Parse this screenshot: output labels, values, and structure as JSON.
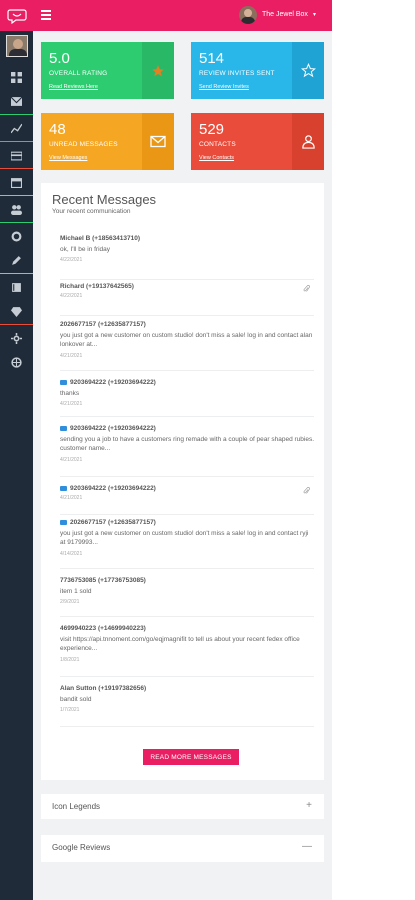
{
  "colors": {
    "accent": "#e91e63",
    "sidebar_bg": "#1f2b39",
    "green": "#2ecc71",
    "blue": "#29b6e8",
    "orange": "#f5a623",
    "red": "#ea4c3b"
  },
  "topbar": {
    "user_name": "The Jewel Box",
    "caret": "▾"
  },
  "sidebar": {
    "items": [
      {
        "icon": "dashboard-icon"
      },
      {
        "icon": "mail-icon"
      },
      {
        "icon": "chart-icon"
      },
      {
        "icon": "card-icon"
      },
      {
        "icon": "calendar-icon"
      },
      {
        "icon": "users-icon"
      },
      {
        "icon": "settings-icon"
      },
      {
        "icon": "edit-icon"
      },
      {
        "icon": "book-icon"
      },
      {
        "icon": "diamond-icon"
      },
      {
        "icon": "gear-icon"
      },
      {
        "icon": "globe-icon"
      }
    ]
  },
  "stats": [
    {
      "value": "5.0",
      "label": "OVERALL RATING",
      "link": "Read Reviews Here",
      "icon": "star-filled-icon"
    },
    {
      "value": "514",
      "label": "REVIEW INVITES SENT",
      "link": "Send Review Invites",
      "icon": "star-outline-icon"
    },
    {
      "value": "48",
      "label": "UNREAD MESSAGES",
      "link": "View Messages",
      "icon": "envelope-icon"
    },
    {
      "value": "529",
      "label": "CONTACTS",
      "link": "View Contacts",
      "icon": "contact-icon"
    }
  ],
  "recent": {
    "title": "Recent Messages",
    "subtitle": "Your recent communication",
    "messages": [
      {
        "from": "Michael B (+18563413710)",
        "body": "ok, I'll be in friday",
        "time": "4/22/2021",
        "flag": false,
        "attachment": false
      },
      {
        "from": "Richard (+19137642565)",
        "body": "",
        "time": "4/22/2021",
        "flag": false,
        "attachment": true
      },
      {
        "from": "2026677157 (+12635877157)",
        "body": "you just got a new customer on custom studio! don't miss a sale! log in and contact alan lonkover at...",
        "time": "4/21/2021",
        "flag": false,
        "attachment": false
      },
      {
        "from": "9203694222 (+19203694222)",
        "body": "thanks",
        "time": "4/21/2021",
        "flag": true,
        "attachment": false
      },
      {
        "from": "9203694222 (+19203694222)",
        "body": "sending you a job to have a customers ring remade with a couple of pear shaped rubies. customer name...",
        "time": "4/21/2021",
        "flag": true,
        "attachment": false
      },
      {
        "from": "9203694222 (+19203694222)",
        "body": "",
        "time": "4/21/2021",
        "flag": true,
        "attachment": true
      },
      {
        "from": "2026677157 (+12635877157)",
        "body": "you just got a new customer on custom studio! don't miss a sale! log in and contact ryji at 9179993...",
        "time": "4/14/2021",
        "flag": true,
        "attachment": false
      },
      {
        "from": "7736753085 (+17736753085)",
        "body": "item 1 sold",
        "time": "2/9/2021",
        "flag": false,
        "attachment": false
      },
      {
        "from": "4699940223 (+14699940223)",
        "body": "visit https://api.tnnoment.com/go/eqjmagnifit to tell us about your recent fedex office experience...",
        "time": "1/8/2021",
        "flag": false,
        "attachment": false
      },
      {
        "from": "Alan Sutton (+19197382656)",
        "body": "bandit sold",
        "time": "1/7/2021",
        "flag": false,
        "attachment": false
      }
    ],
    "read_more": "READ MORE MESSAGES"
  },
  "accordions": [
    {
      "title": "Icon Legends",
      "toggle": "+"
    },
    {
      "title": "Google Reviews",
      "toggle": "—"
    }
  ]
}
